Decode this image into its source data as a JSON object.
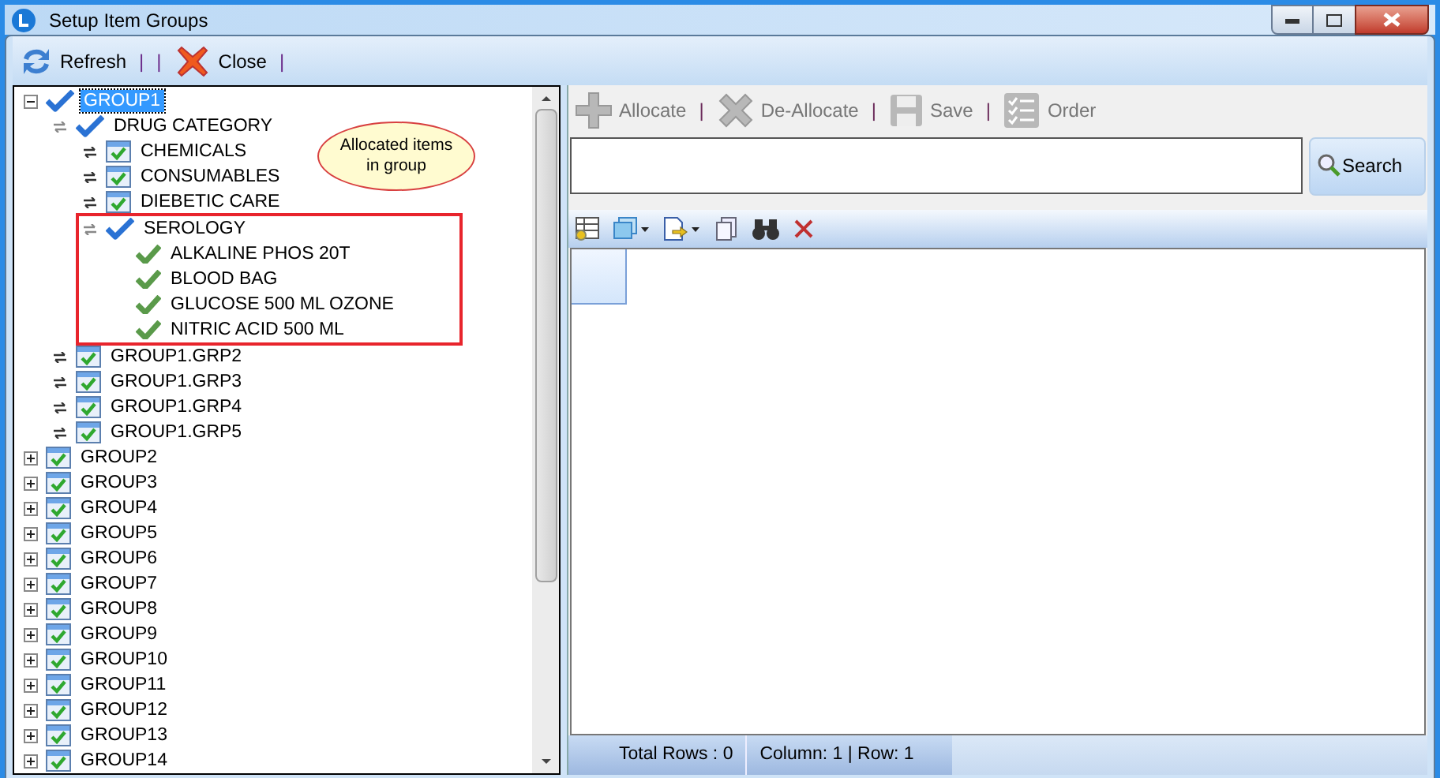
{
  "window": {
    "title": "Setup Item Groups"
  },
  "toolbar": [
    {
      "kind": "refresh",
      "label": "Refresh"
    },
    {
      "kind": "separator",
      "label": "|"
    },
    {
      "kind": "separator",
      "label": "|"
    },
    {
      "kind": "close",
      "label": "Close"
    },
    {
      "kind": "separator",
      "label": "|"
    }
  ],
  "tree": [
    {
      "label": "GROUP1",
      "kind": "tick",
      "expanded": true,
      "selected": true,
      "children": [
        {
          "label": "DRUG CATEGORY",
          "kind": "tick",
          "expanded": true,
          "selected": false,
          "children": [
            {
              "label": "CHEMICALS",
              "kind": "box",
              "expanded": false,
              "selected": false
            },
            {
              "label": "CONSUMABLES",
              "kind": "box",
              "expanded": false,
              "selected": false
            },
            {
              "label": "DIEBETIC CARE",
              "kind": "box",
              "expanded": false,
              "selected": false
            },
            {
              "label": "SEROLOGY",
              "kind": "tick",
              "expanded": true,
              "selected": false,
              "highlighted": true,
              "children": [
                {
                  "label": "ALKALINE PHOS 20T",
                  "kind": "item",
                  "selected": false
                },
                {
                  "label": "BLOOD BAG",
                  "kind": "item",
                  "selected": false
                },
                {
                  "label": "GLUCOSE 500 ML OZONE",
                  "kind": "item",
                  "selected": false
                },
                {
                  "label": "NITRIC ACID 500 ML",
                  "kind": "item",
                  "selected": false
                }
              ]
            }
          ]
        },
        {
          "label": "GROUP1.GRP2",
          "kind": "box",
          "expanded": false,
          "selected": false
        },
        {
          "label": "GROUP1.GRP3",
          "kind": "box",
          "expanded": false,
          "selected": false
        },
        {
          "label": "GROUP1.GRP4",
          "kind": "box",
          "expanded": false,
          "selected": false
        },
        {
          "label": "GROUP1.GRP5",
          "kind": "box",
          "expanded": false,
          "selected": false
        }
      ]
    },
    {
      "label": "GROUP2",
      "kind": "box",
      "expanded": false,
      "selected": false
    },
    {
      "label": "GROUP3",
      "kind": "box",
      "expanded": false,
      "selected": false
    },
    {
      "label": "GROUP4",
      "kind": "box",
      "expanded": false,
      "selected": false
    },
    {
      "label": "GROUP5",
      "kind": "box",
      "expanded": false,
      "selected": false
    },
    {
      "label": "GROUP6",
      "kind": "box",
      "expanded": false,
      "selected": false
    },
    {
      "label": "GROUP7",
      "kind": "box",
      "expanded": false,
      "selected": false
    },
    {
      "label": "GROUP8",
      "kind": "box",
      "expanded": false,
      "selected": false
    },
    {
      "label": "GROUP9",
      "kind": "box",
      "expanded": false,
      "selected": false
    },
    {
      "label": "GROUP10",
      "kind": "box",
      "expanded": false,
      "selected": false
    },
    {
      "label": "GROUP11",
      "kind": "box",
      "expanded": false,
      "selected": false
    },
    {
      "label": "GROUP12",
      "kind": "box",
      "expanded": false,
      "selected": false
    },
    {
      "label": "GROUP13",
      "kind": "box",
      "expanded": false,
      "selected": false
    },
    {
      "label": "GROUP14",
      "kind": "box",
      "expanded": false,
      "selected": false
    }
  ],
  "callout": {
    "text": "Allocated items in group"
  },
  "actions": [
    {
      "label": "Allocate",
      "disabled": true
    },
    {
      "label": "De-Allocate",
      "disabled": true
    },
    {
      "label": "Save",
      "disabled": true
    },
    {
      "label": "Order",
      "disabled": true
    }
  ],
  "action_separator": "|",
  "search": {
    "button": "Search"
  },
  "status_bar": {
    "total_rows": "Total Rows : 0",
    "position": "Column: 1 | Row: 1"
  }
}
